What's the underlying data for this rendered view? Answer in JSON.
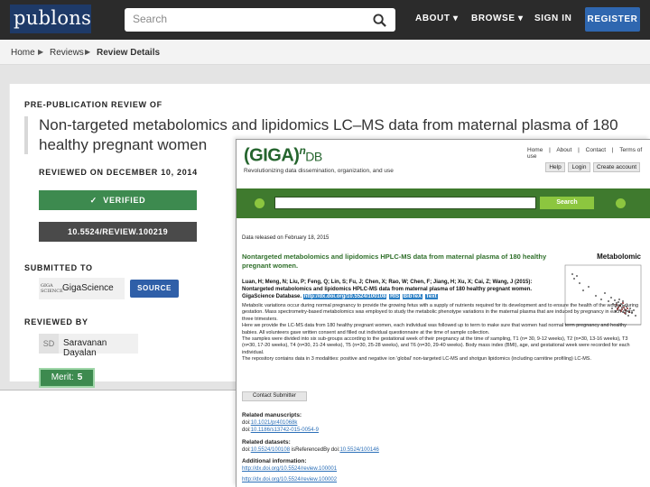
{
  "header": {
    "logo": "publons",
    "search_placeholder": "Search",
    "nav": [
      "ABOUT",
      "BROWSE",
      "SIGN IN"
    ],
    "register_label": "REGISTER"
  },
  "breadcrumb": [
    "Home",
    "Reviews",
    "Review Details"
  ],
  "review": {
    "pre_label": "PRE-PUBLICATION REVIEW OF",
    "title": "Non-targeted metabolomics and lipidomics LC–MS data from maternal plasma of 180 healthy pregnant women",
    "reviewed_on": "REVIEWED ON DECEMBER 10, 2014",
    "verified_label": "VERIFIED",
    "doi": "10.5524/REVIEW.100219",
    "submitted_to_label": "SUBMITTED TO",
    "journal_logo": "GIGA SCIENCE",
    "journal_name": "GigaScience",
    "source_label": "SOURCE",
    "reviewed_by_label": "REVIEWED BY",
    "reviewer_initials": "SD",
    "reviewer_name": "Saravanan Dayalan",
    "merit_label": "Merit:",
    "merit_value": "5"
  },
  "gigadb": {
    "logo_main": "(GIGA)",
    "logo_sup": "n",
    "logo_db": "DB",
    "tagline": "Revolutionizing data dissemination, organization, and use",
    "top_links": [
      "Home",
      "|",
      "About",
      "|",
      "Contact",
      "|",
      "Terms of use"
    ],
    "buttons": [
      "Help",
      "Login",
      "Create account"
    ],
    "search_button": "Search",
    "released": "Data released on February 18, 2015",
    "title": "Nontargeted metabolomics and lipidomics HPLC-MS data from maternal plasma of 180 healthy pregnant women.",
    "side_label": "Metabolomic",
    "authors": "Luan, H; Meng, N; Liu, P; Feng, Q; Lin, S; Fu, J; Chen, X; Rao, W; Chen, F; Jiang, H; Xu, X; Cai, Z; Wang, J (2015): Nontargeted metabolomics and lipidomics HPLC-MS data from maternal plasma of 180 healthy pregnant women. GigaScience Database.",
    "authors_doi": "http://dx.doi.org/10.5524/100108",
    "badges": [
      "RIS",
      "BibTeX",
      "Text"
    ],
    "abstract": [
      "Metabolic variations occur during normal pregnancy to provide the growing fetus with a supply of nutrients required for its development and to ensure the health of the woman during gestation. Mass spectrometry-based metabolomics was employed to study the metabolic phenotype variations in the maternal plasma that are induced by pregnancy in each of its three trimesters.",
      "Here we provide the LC-MS data from 180 healthy pregnant women, each individual was followed up to term to make sure that women had normal term pregnancy and healthy babies. All volunteers gave written consent and filled out individual questionnaire at the time of sample collection.",
      "The samples were divided into six sub-groups according to the gestational week of their pregnancy at the time of sampling, T1 (n= 30, 9-12 weeks), T2 (n=30, 13-16 weeks), T3 (n=30, 17-20 weeks), T4 (n=30, 21-24 weeks), T5 (n=30, 25-28 weeks), and T6 (n=30, 29-40 weeks). Body mass index (BMI), age, and gestational week were recorded for each individual.",
      "The repository contains data in 3 modalities: positive and negative ion 'global' non-targeted LC-MS and shotgun lipidomics (including carnitine profiling) LC-MS."
    ],
    "contact_button": "Contact Submitter",
    "related_manuscripts_label": "Related manuscripts:",
    "manuscripts": [
      {
        "prefix": "doi:",
        "link": "10.1021/pr401068k"
      },
      {
        "prefix": "doi:",
        "link": "10.1186/s13742-015-0054-9"
      }
    ],
    "related_datasets_label": "Related datasets:",
    "datasets": {
      "prefix": "doi:",
      "link1": "10.5524/100108",
      "middle": " isReferencedBy doi:",
      "link2": "10.5524/100146"
    },
    "additional_label": "Additional information:",
    "additional": [
      "http://dx.doi.org/10.5524/review.100001",
      "http://dx.doi.org/10.5524/review.100002"
    ]
  }
}
